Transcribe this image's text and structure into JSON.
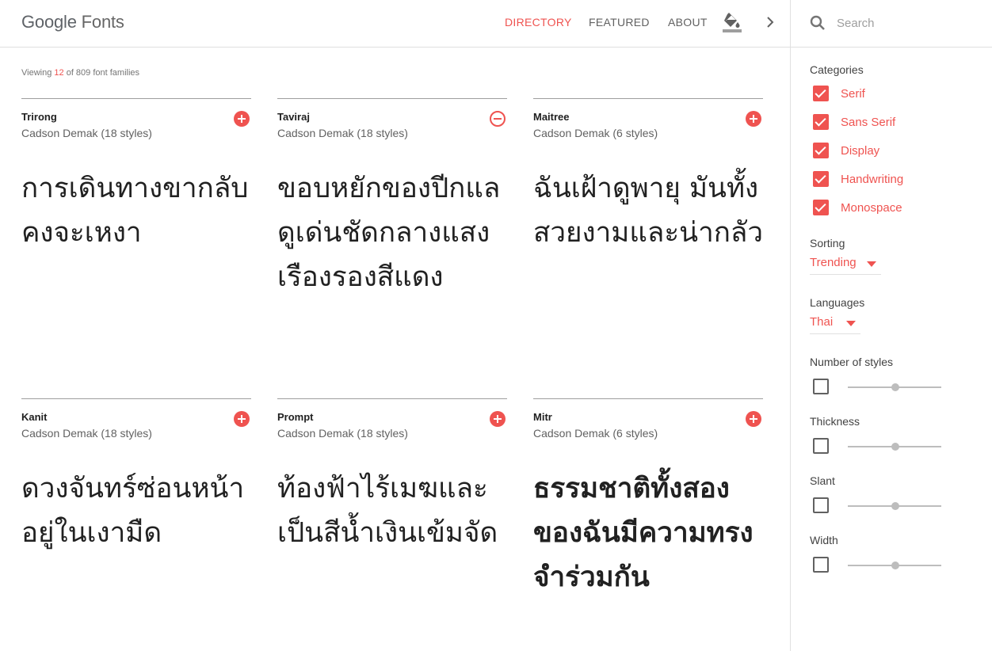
{
  "header": {
    "logo_google": "Google",
    "logo_fonts": "Fonts",
    "nav": {
      "directory": "DIRECTORY",
      "featured": "FEATURED",
      "about": "ABOUT"
    },
    "icons": {
      "paint": "format-color-fill-icon",
      "next": "chevron-right-icon"
    }
  },
  "search": {
    "placeholder": "Search",
    "value": ""
  },
  "summary": {
    "prefix": "Viewing ",
    "count": "12",
    "suffix": " of 809 font families"
  },
  "cards": [
    {
      "name": "Trirong",
      "author": "Cadson Demak (18 styles)",
      "action": "add",
      "sample": "การเดินทางขากลับคงจะเหงา"
    },
    {
      "name": "Taviraj",
      "author": "Cadson Demak (18 styles)",
      "action": "remove",
      "sample": "ขอบหยักของปีกแลดูเด่นชัดกลางแสงเรืองรองสีแดง"
    },
    {
      "name": "Maitree",
      "author": "Cadson Demak (6 styles)",
      "action": "add",
      "sample": "ฉันเฝ้าดูพายุ มันทั้งสวยงามและน่ากลัว"
    },
    {
      "name": "Kanit",
      "author": "Cadson Demak (18 styles)",
      "action": "add",
      "sample": "ดวงจันทร์ซ่อนหน้าอยู่ในเงามืด"
    },
    {
      "name": "Prompt",
      "author": "Cadson Demak (18 styles)",
      "action": "add",
      "sample": "ท้องฟ้าไร้เมฆและเป็นสีน้ำเงินเข้มจัด"
    },
    {
      "name": "Mitr",
      "author": "Cadson Demak (6 styles)",
      "action": "add",
      "sample": "ธรรมชาติทั้งสองของฉันมีความทรงจำร่วมกัน"
    }
  ],
  "sidebar": {
    "categories_label": "Categories",
    "categories": [
      {
        "label": "Serif",
        "checked": true
      },
      {
        "label": "Sans Serif",
        "checked": true
      },
      {
        "label": "Display",
        "checked": true
      },
      {
        "label": "Handwriting",
        "checked": true
      },
      {
        "label": "Monospace",
        "checked": true
      }
    ],
    "sorting_label": "Sorting",
    "sorting_value": "Trending",
    "languages_label": "Languages",
    "languages_value": "Thai",
    "filters": [
      {
        "label": "Number of styles",
        "enabled": false
      },
      {
        "label": "Thickness",
        "enabled": false
      },
      {
        "label": "Slant",
        "enabled": false
      },
      {
        "label": "Width",
        "enabled": false
      }
    ]
  },
  "colors": {
    "accent": "#ef5350",
    "text": "#212121",
    "secondary": "#616161",
    "divider": "#e0e0e0"
  }
}
